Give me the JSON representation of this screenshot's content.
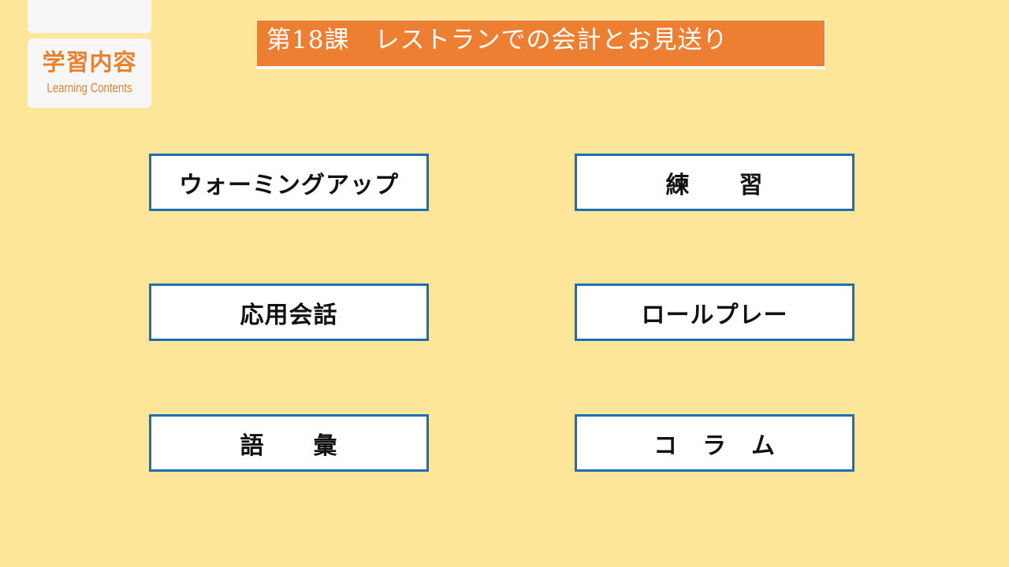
{
  "sidebar": {
    "card_title": "学習内容",
    "card_subtitle": "Learning Contents"
  },
  "header": {
    "title": "第18課　レストランでの会計とお見送り"
  },
  "menu": {
    "items": [
      {
        "label": "ウォーミングアップ"
      },
      {
        "label": "練　　習"
      },
      {
        "label": "応用会話"
      },
      {
        "label": "ロールプレー"
      },
      {
        "label": "語　　彙"
      },
      {
        "label": "コ　ラ　ム"
      }
    ]
  },
  "colors": {
    "background": "#fde599",
    "accent": "#ed7f33",
    "button_border": "#1c6fb0"
  }
}
